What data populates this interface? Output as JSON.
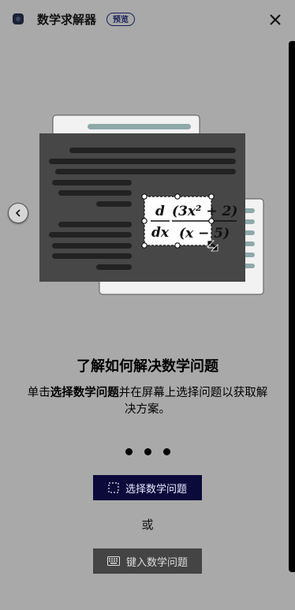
{
  "header": {
    "title": "数学求解器",
    "badge": "预览"
  },
  "illustration": {
    "formula_d": "d",
    "formula_dx": "dx",
    "formula_numerator": "(3x² + 2)",
    "formula_denominator": "(x − 5)"
  },
  "onboarding": {
    "heading": "了解如何解决数学问题",
    "desc_part1": "单击",
    "desc_bold": "选择数学问题",
    "desc_part2": "并在屏幕上选择问题以获取解决方案。",
    "step_count": 3,
    "primary_button": "选择数学问题",
    "or_text": "或",
    "secondary_button": "键入数学问题"
  },
  "colors": {
    "background": "#a9a9a9",
    "primary_button": "#0b0a3a",
    "secondary_button": "#444444"
  }
}
